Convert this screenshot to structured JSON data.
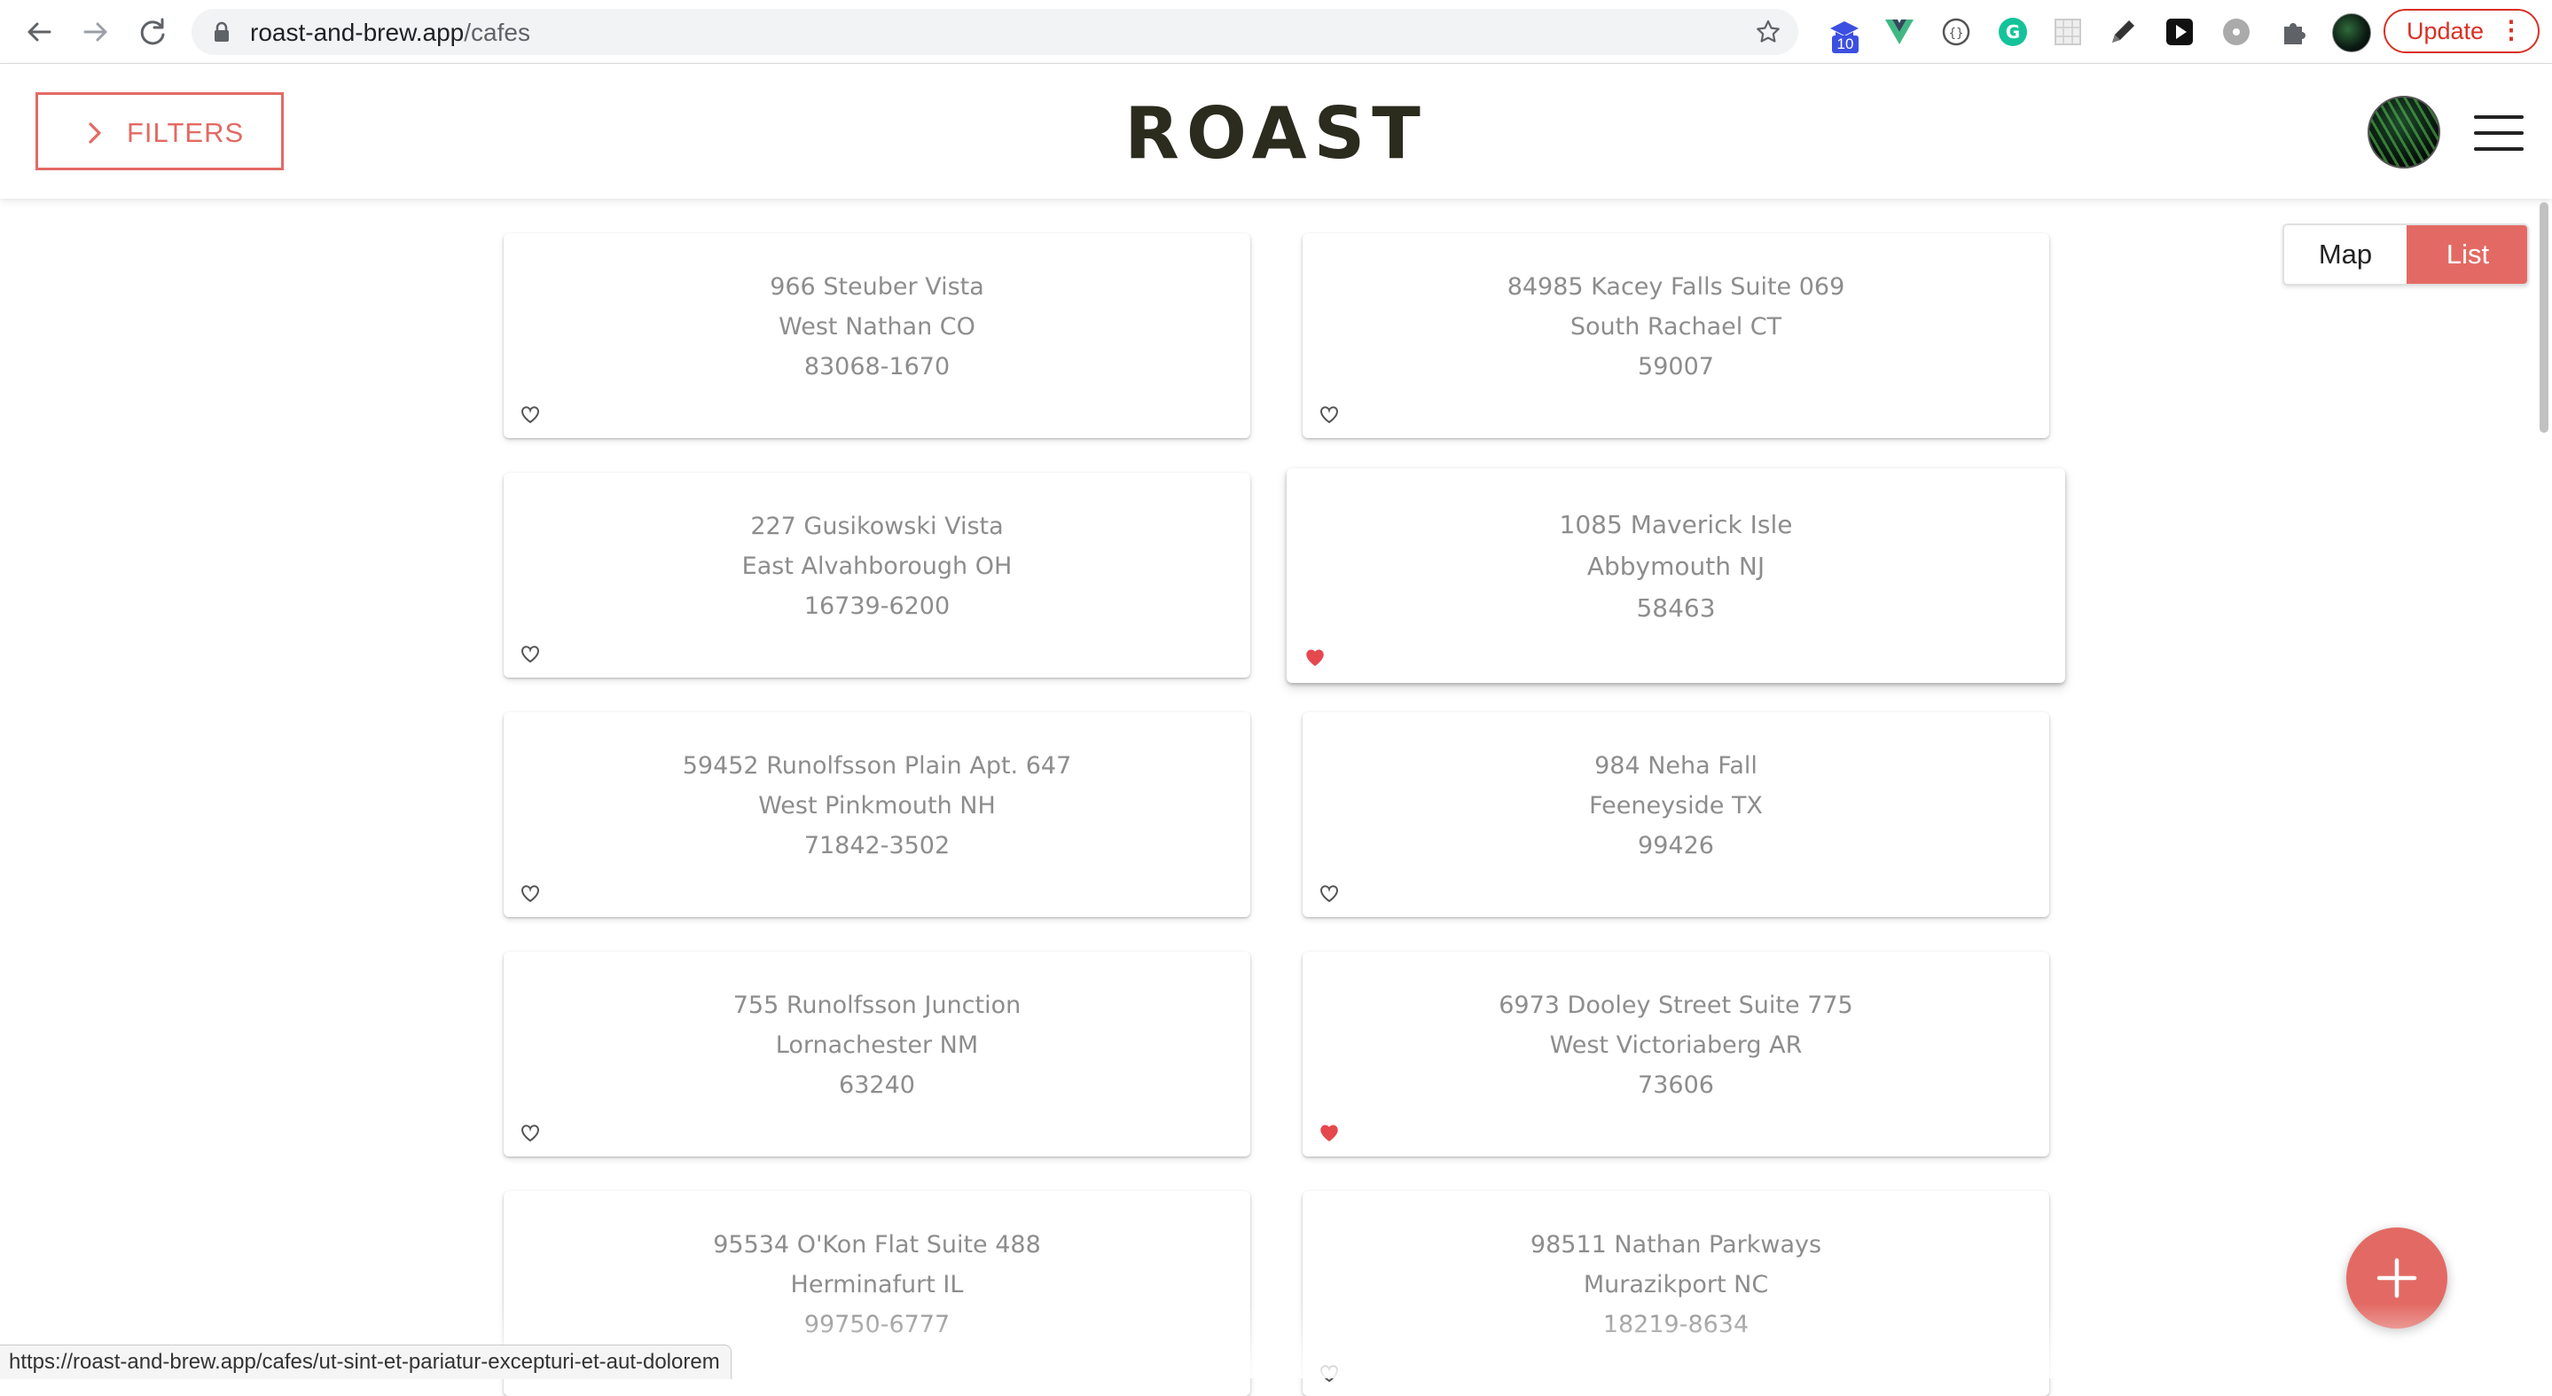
{
  "browser": {
    "url_host": "roast-and-brew.app",
    "url_path": "/cafes",
    "extension_badge": "10",
    "update_label": "Update",
    "status_url": "https://roast-and-brew.app/cafes/ut-sint-et-pariatur-excepturi-et-aut-dolorem"
  },
  "header": {
    "filters_label": "FILTERS",
    "brand": "ROAST"
  },
  "view_toggle": {
    "map_label": "Map",
    "list_label": "List",
    "active": "List"
  },
  "colors": {
    "accent": "#e36a64",
    "brand_text": "#2b2b1e",
    "card_text": "#8d8d8d"
  },
  "cafes": [
    {
      "street": "966 Steuber Vista",
      "city": "West Nathan CO",
      "zip": "83068-1670",
      "liked": false
    },
    {
      "street": "84985 Kacey Falls Suite 069",
      "city": "South Rachael CT",
      "zip": "59007",
      "liked": false
    },
    {
      "street": "227 Gusikowski Vista",
      "city": "East Alvahborough OH",
      "zip": "16739-6200",
      "liked": false
    },
    {
      "street": "1085 Maverick Isle",
      "city": "Abbymouth NJ",
      "zip": "58463",
      "liked": true
    },
    {
      "street": "59452 Runolfsson Plain Apt. 647",
      "city": "West Pinkmouth NH",
      "zip": "71842-3502",
      "liked": false
    },
    {
      "street": "984 Neha Fall",
      "city": "Feeneyside TX",
      "zip": "99426",
      "liked": false
    },
    {
      "street": "755 Runolfsson Junction",
      "city": "Lornachester NM",
      "zip": "63240",
      "liked": false
    },
    {
      "street": "6973 Dooley Street Suite 775",
      "city": "West Victoriaberg AR",
      "zip": "73606",
      "liked": true
    },
    {
      "street": "95534 O'Kon Flat Suite 488",
      "city": "Herminafurt IL",
      "zip": "99750-6777",
      "liked": false
    },
    {
      "street": "98511 Nathan Parkways",
      "city": "Murazikport NC",
      "zip": "18219-8634",
      "liked": false
    }
  ]
}
